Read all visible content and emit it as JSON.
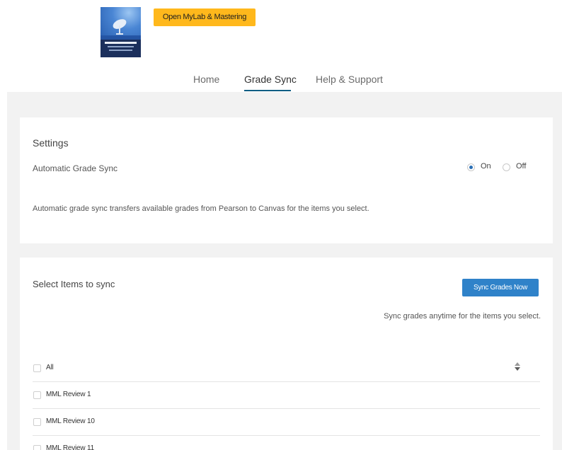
{
  "header": {
    "open_button_label": "Open MyLab & Mastering",
    "book_cover_icon": "book-cover-image"
  },
  "nav": {
    "tabs": [
      {
        "label": "Home",
        "active": false
      },
      {
        "label": "Grade Sync",
        "active": true
      },
      {
        "label": "Help & Support",
        "active": false
      }
    ]
  },
  "settings": {
    "title": "Settings",
    "automatic_grade_sync_label": "Automatic Grade Sync",
    "radio_on_label": "On",
    "radio_off_label": "Off",
    "selected": "On",
    "description": "Automatic grade sync transfers available grades from Pearson to Canvas for the items you select."
  },
  "items": {
    "title": "Select Items to sync",
    "sync_button_label": "Sync Grades Now",
    "sync_description": "Sync grades anytime for the items you select.",
    "list": [
      {
        "label": "All",
        "checked": false
      },
      {
        "label": "MML Review 1",
        "checked": false
      },
      {
        "label": "MML Review 10",
        "checked": false
      },
      {
        "label": "MML Review 11",
        "checked": false
      }
    ],
    "sort_icon": "sort-icon"
  },
  "colors": {
    "accent_yellow": "#ffb81c",
    "button_blue": "#2f82c9",
    "tab_underline": "#0c5d84",
    "background_gray": "#f2f2f2"
  }
}
